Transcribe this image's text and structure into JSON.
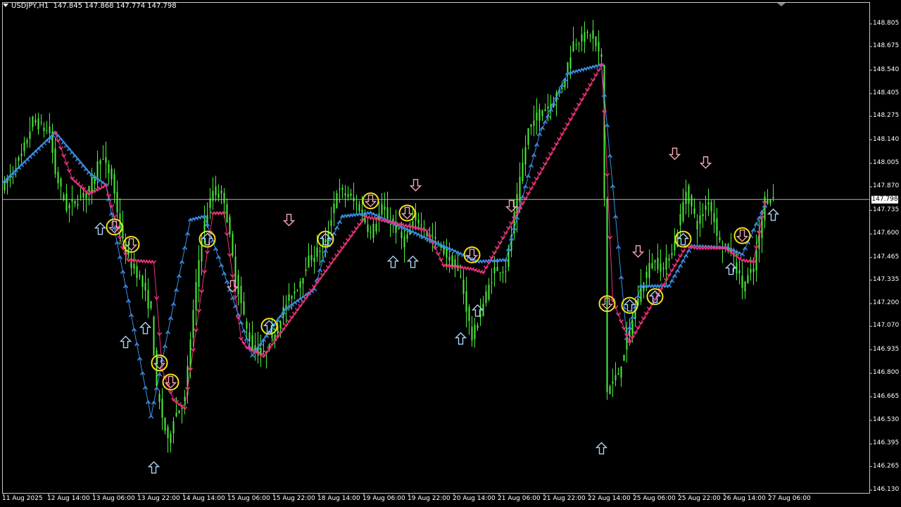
{
  "header": {
    "symbol": "USDJPY,H1",
    "ohlc": "147.845 147.868 147.774 147.798"
  },
  "current_price": "147.798",
  "colors": {
    "background": "#000000",
    "candles": "#4CF03C",
    "buy_trail": "#3A8EE6",
    "sell_trail": "#E8327A",
    "circle": "#F2E31B",
    "up_arrow": "#A9D3F5",
    "down_arrow": "#F2A6B4",
    "price_line": "#B4B4B4"
  },
  "chart_data": {
    "type": "candlestick",
    "symbol": "USDJPY",
    "timeframe": "H1",
    "ylim": [
      146.1,
      148.9
    ],
    "y_ticks": [
      "148.805",
      "148.675",
      "148.540",
      "148.405",
      "148.275",
      "148.140",
      "148.005",
      "147.870",
      "147.735",
      "147.600",
      "147.465",
      "147.335",
      "147.200",
      "147.070",
      "146.935",
      "146.800",
      "146.665",
      "146.530",
      "146.395",
      "146.265",
      "146.130"
    ],
    "x_ticks": [
      "11 Aug 2025",
      "12 Aug 14:00",
      "13 Aug 06:00",
      "13 Aug 22:00",
      "14 Aug 14:00",
      "15 Aug 06:00",
      "15 Aug 22:00",
      "18 Aug 14:00",
      "19 Aug 06:00",
      "19 Aug 22:00",
      "20 Aug 14:00",
      "21 Aug 06:00",
      "21 Aug 22:00",
      "22 Aug 14:00",
      "25 Aug 06:00",
      "25 Aug 22:00",
      "26 Aug 14:00",
      "27 Aug 06:00"
    ],
    "anchors": [
      [
        0,
        147.88
      ],
      [
        6,
        148.05
      ],
      [
        10,
        148.25
      ],
      [
        16,
        148.18
      ],
      [
        18,
        147.95
      ],
      [
        22,
        147.75
      ],
      [
        26,
        147.8
      ],
      [
        30,
        147.85
      ],
      [
        34,
        148.05
      ],
      [
        38,
        147.92
      ],
      [
        42,
        147.55
      ],
      [
        44,
        147.45
      ],
      [
        48,
        147.35
      ],
      [
        52,
        147.15
      ],
      [
        54,
        146.7
      ],
      [
        58,
        146.4
      ],
      [
        60,
        146.55
      ],
      [
        64,
        146.65
      ],
      [
        66,
        147.0
      ],
      [
        70,
        147.6
      ],
      [
        74,
        147.85
      ],
      [
        78,
        147.8
      ],
      [
        82,
        147.35
      ],
      [
        86,
        147.05
      ],
      [
        88,
        146.95
      ],
      [
        92,
        146.9
      ],
      [
        96,
        147.05
      ],
      [
        100,
        147.2
      ],
      [
        104,
        147.3
      ],
      [
        108,
        147.45
      ],
      [
        114,
        147.55
      ],
      [
        118,
        147.85
      ],
      [
        122,
        147.82
      ],
      [
        126,
        147.75
      ],
      [
        130,
        147.6
      ],
      [
        134,
        147.75
      ],
      [
        138,
        147.65
      ],
      [
        142,
        147.55
      ],
      [
        146,
        147.7
      ],
      [
        150,
        147.6
      ],
      [
        154,
        147.55
      ],
      [
        158,
        147.45
      ],
      [
        162,
        147.35
      ],
      [
        166,
        147.0
      ],
      [
        170,
        147.2
      ],
      [
        174,
        147.4
      ],
      [
        178,
        147.4
      ],
      [
        182,
        147.8
      ],
      [
        186,
        148.2
      ],
      [
        190,
        148.3
      ],
      [
        194,
        148.35
      ],
      [
        198,
        148.45
      ],
      [
        202,
        148.7
      ],
      [
        208,
        148.75
      ],
      [
        212,
        148.6
      ],
      [
        213,
        147.8
      ],
      [
        214,
        146.7
      ],
      [
        218,
        146.8
      ],
      [
        222,
        147.05
      ],
      [
        226,
        147.3
      ],
      [
        230,
        147.45
      ],
      [
        234,
        147.4
      ],
      [
        238,
        147.55
      ],
      [
        242,
        147.85
      ],
      [
        246,
        147.65
      ],
      [
        250,
        147.8
      ],
      [
        254,
        147.55
      ],
      [
        258,
        147.5
      ],
      [
        262,
        147.3
      ],
      [
        266,
        147.4
      ],
      [
        270,
        147.8
      ],
      [
        273,
        147.8
      ]
    ],
    "buy_trail": [
      [
        0,
        147.9
      ],
      [
        18,
        148.18
      ],
      [
        30,
        147.95
      ],
      [
        36,
        147.88
      ],
      [
        52,
        146.55
      ],
      [
        66,
        147.68
      ],
      [
        71,
        147.7
      ],
      [
        88,
        146.9
      ],
      [
        100,
        147.17
      ],
      [
        110,
        147.28
      ],
      [
        114,
        147.5
      ],
      [
        120,
        147.7
      ],
      [
        130,
        147.72
      ],
      [
        168,
        147.44
      ],
      [
        178,
        147.45
      ],
      [
        190,
        148.17
      ],
      [
        200,
        148.52
      ],
      [
        212,
        148.57
      ],
      [
        221,
        147.0
      ],
      [
        226,
        147.3
      ],
      [
        236,
        147.3
      ],
      [
        244,
        147.53
      ],
      [
        257,
        147.52
      ],
      [
        262,
        147.48
      ],
      [
        270,
        147.76
      ]
    ],
    "sell_trail": [
      [
        18,
        148.18
      ],
      [
        24,
        147.92
      ],
      [
        30,
        147.83
      ],
      [
        36,
        147.88
      ],
      [
        42,
        147.52
      ],
      [
        44,
        147.45
      ],
      [
        53,
        147.44
      ],
      [
        56,
        146.82
      ],
      [
        60,
        146.65
      ],
      [
        64,
        146.6
      ],
      [
        74,
        147.72
      ],
      [
        78,
        147.72
      ],
      [
        84,
        147.0
      ],
      [
        86,
        146.95
      ],
      [
        92,
        146.9
      ],
      [
        128,
        147.7
      ],
      [
        134,
        147.68
      ],
      [
        150,
        147.62
      ],
      [
        156,
        147.42
      ],
      [
        166,
        147.4
      ],
      [
        170,
        147.38
      ],
      [
        212,
        148.57
      ],
      [
        213,
        148.3
      ],
      [
        216,
        147.22
      ],
      [
        222,
        146.98
      ],
      [
        242,
        147.53
      ],
      [
        246,
        147.52
      ],
      [
        256,
        147.52
      ],
      [
        262,
        147.45
      ],
      [
        266,
        147.44
      ],
      [
        270,
        147.78
      ]
    ],
    "circles_down": [
      [
        39,
        147.64
      ],
      [
        45,
        147.54
      ],
      [
        55,
        146.86
      ],
      [
        59,
        146.75
      ],
      [
        130,
        147.79
      ],
      [
        143,
        147.72
      ],
      [
        166,
        147.48
      ],
      [
        214,
        147.2
      ],
      [
        262,
        147.59
      ]
    ],
    "circles_up": [
      [
        72,
        147.57
      ],
      [
        94,
        147.07
      ],
      [
        114,
        147.57
      ],
      [
        222,
        147.19
      ],
      [
        231,
        147.24
      ],
      [
        241,
        147.57
      ]
    ],
    "arrows_up": [
      [
        34,
        147.63
      ],
      [
        43,
        146.98
      ],
      [
        50,
        147.06
      ],
      [
        53,
        146.26
      ],
      [
        138,
        147.44
      ],
      [
        145,
        147.44
      ],
      [
        162,
        147.0
      ],
      [
        168,
        147.16
      ],
      [
        212,
        146.37
      ],
      [
        258,
        147.4
      ],
      [
        273,
        147.71
      ]
    ],
    "arrows_down": [
      [
        81,
        147.3
      ],
      [
        101,
        147.68
      ],
      [
        146,
        147.88
      ],
      [
        180,
        147.76
      ],
      [
        225,
        147.5
      ],
      [
        238,
        148.06
      ],
      [
        249,
        148.01
      ]
    ]
  }
}
